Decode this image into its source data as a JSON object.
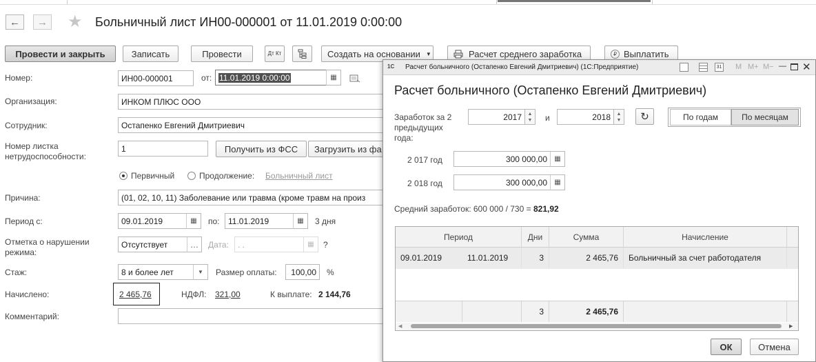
{
  "window": {
    "title": "Больничный лист ИН00-000001 от 11.01.2019 0:00:00"
  },
  "toolbar": {
    "post_close": "Провести и закрыть",
    "write": "Записать",
    "post": "Провести",
    "dt_kt": "Дт Кт",
    "create_based": "Создать на основании",
    "calc_avg": "Расчет среднего заработка",
    "pay": "Выплатить"
  },
  "form": {
    "number_label": "Номер:",
    "number_value": "ИН00-000001",
    "from_label": "от:",
    "date_value": "11.01.2019  0:00:00",
    "org_label": "Организация:",
    "org_value": "ИНКОМ ПЛЮС ООО",
    "employee_label": "Сотрудник:",
    "employee_value": "Остапенко Евгений Дмитриевич",
    "sheet_number_label_1": "Номер листка",
    "sheet_number_label_2": "нетрудоспособности:",
    "sheet_number_value": "1",
    "get_fss": "Получить из ФСС",
    "load_from": "Загрузить из фа",
    "primary_label": "Первичный",
    "continuation_label": "Продолжение:",
    "continuation_link": "Больничный лист",
    "reason_label": "Причина:",
    "reason_value": "(01, 02, 10, 11) Заболевание или травма (кроме травм на произ",
    "period_label": "Период с:",
    "period_from": "09.01.2019",
    "period_to_label": "по:",
    "period_to": "11.01.2019",
    "days": "3 дня",
    "violation_label_1": "Отметка о нарушении",
    "violation_label_2": "режима:",
    "violation_value": "Отсутствует",
    "violation_date_label": "Дата:",
    "violation_date_value": " .  .",
    "question": "?",
    "stazh_label": "Стаж:",
    "stazh_value": "8 и более лет",
    "pay_size_label": "Размер оплаты:",
    "pay_size_value": "100,00",
    "percent": "%",
    "accrued_label": "Начислено:",
    "accrued_value": "2 465,76",
    "ndfl_label": "НДФЛ:",
    "ndfl_value": "321,00",
    "to_pay_label": "К выплате:",
    "to_pay_value": "2 144,76",
    "comment_label": "Комментарий:"
  },
  "dialog": {
    "window_title": "Расчет больничного (Остапенко Евгений Дмитриевич)  (1С:Предприятие)",
    "heading": "Расчет больничного (Остапенко Евгений Дмитриевич)",
    "earnings_label_1": "Заработок за 2",
    "earnings_label_2": "предыдущих",
    "earnings_label_3": "года:",
    "year1": "2017",
    "and_label": "и",
    "year2": "2018",
    "by_years": "По годам",
    "by_months": "По месяцам",
    "year1_label": "2 017 год",
    "year1_amount": "300 000,00",
    "year2_label": "2 018 год",
    "year2_amount": "300 000,00",
    "avg_label": "Средний заработок: 600 000 / 730 = ",
    "avg_value": "821,92",
    "table": {
      "headers": [
        "Период",
        "Дни",
        "Сумма",
        "Начисление"
      ],
      "rows": [
        {
          "from": "09.01.2019",
          "to": "11.01.2019",
          "days": "3",
          "sum": "2 465,76",
          "accrual": "Больничный за счет работодателя"
        }
      ],
      "footer": {
        "days": "3",
        "sum": "2 465,76"
      }
    },
    "ok": "ОК",
    "cancel": "Отмена",
    "title_icons": [
      "save-icon",
      "table-icon",
      "calendar-icon",
      "M",
      "M+",
      "M−"
    ]
  }
}
